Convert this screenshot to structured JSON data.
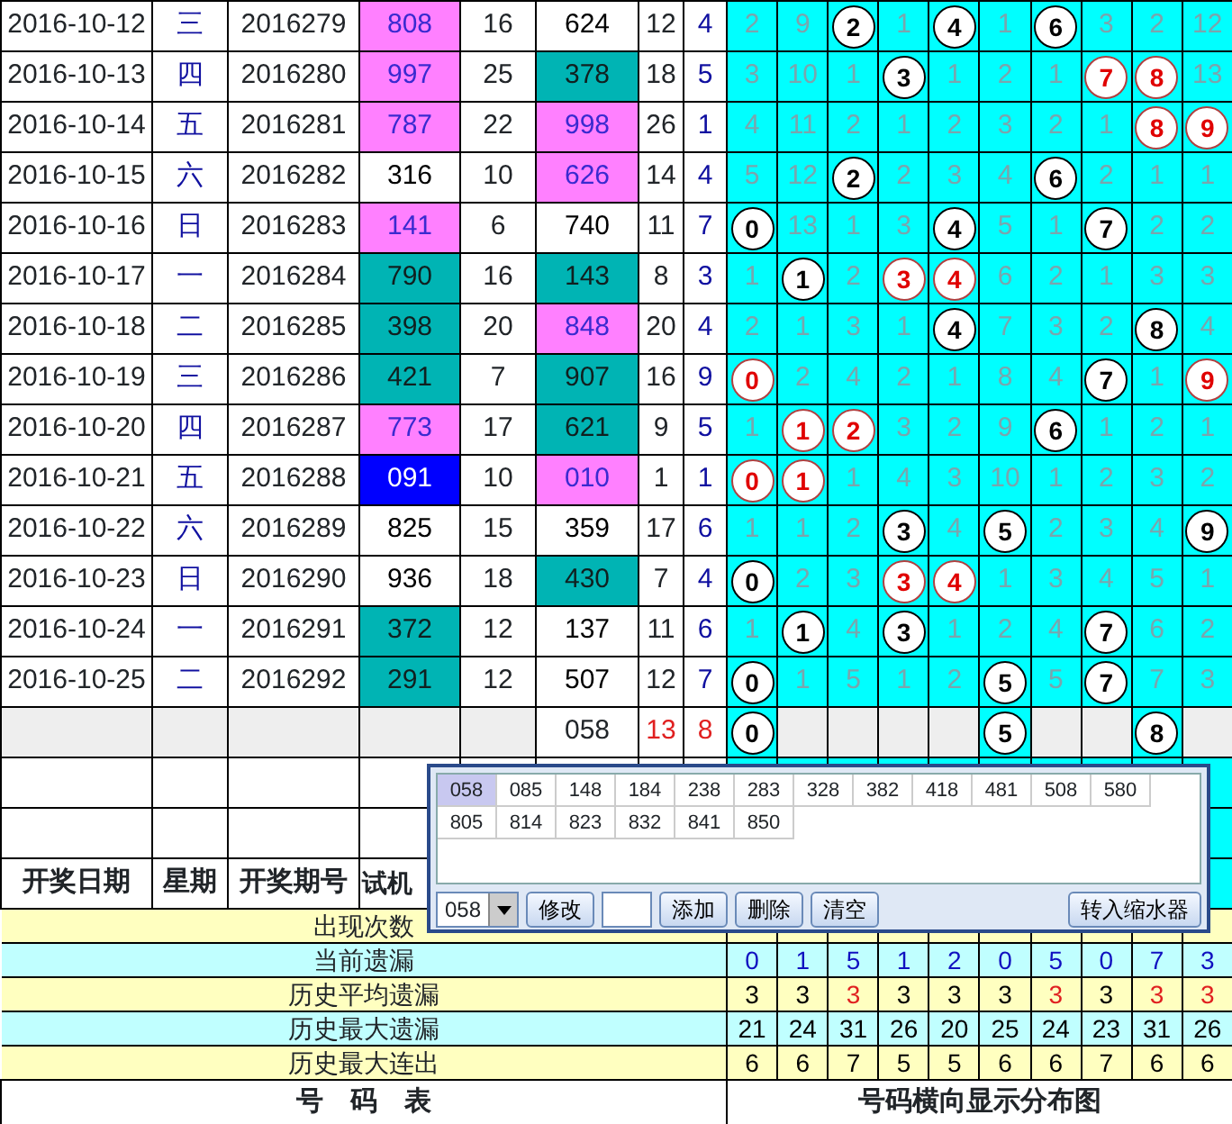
{
  "rows": [
    {
      "date": "2016-10-12",
      "weekday": "三",
      "issue": "2016279",
      "trial": {
        "text": "808",
        "color": "#ff80ff"
      },
      "trial_sum": "16",
      "number": {
        "text": "624",
        "color": "#ffffff"
      },
      "number_sum": "12",
      "column_9": "4",
      "dist": [
        {
          "text": "2",
          "kind": "miss"
        },
        {
          "text": "9",
          "kind": "miss"
        },
        {
          "text": "2",
          "kind": "ball"
        },
        {
          "text": "1",
          "kind": "miss"
        },
        {
          "text": "4",
          "kind": "ball"
        },
        {
          "text": "1",
          "kind": "miss"
        },
        {
          "text": "6",
          "kind": "ball"
        },
        {
          "text": "3",
          "kind": "miss"
        },
        {
          "text": "2",
          "kind": "miss"
        },
        {
          "text": "12",
          "kind": "miss"
        }
      ]
    },
    {
      "date": "2016-10-13",
      "weekday": "四",
      "issue": "2016280",
      "trial": {
        "text": "997",
        "color": "#ff80ff"
      },
      "trial_sum": "25",
      "number": {
        "text": "378",
        "color": "#00b4b4"
      },
      "number_sum": "18",
      "column_9": "5",
      "dist": [
        {
          "text": "3",
          "kind": "miss"
        },
        {
          "text": "10",
          "kind": "miss"
        },
        {
          "text": "1",
          "kind": "miss"
        },
        {
          "text": "3",
          "kind": "ball"
        },
        {
          "text": "1",
          "kind": "miss"
        },
        {
          "text": "2",
          "kind": "miss"
        },
        {
          "text": "1",
          "kind": "miss"
        },
        {
          "text": "7",
          "kind": "repeat"
        },
        {
          "text": "8",
          "kind": "repeat"
        },
        {
          "text": "13",
          "kind": "miss"
        }
      ]
    },
    {
      "date": "2016-10-14",
      "weekday": "五",
      "issue": "2016281",
      "trial": {
        "text": "787",
        "color": "#ff80ff"
      },
      "trial_sum": "22",
      "number": {
        "text": "998",
        "color": "#ff80ff"
      },
      "number_sum": "26",
      "column_9": "1",
      "dist": [
        {
          "text": "4",
          "kind": "miss"
        },
        {
          "text": "11",
          "kind": "miss"
        },
        {
          "text": "2",
          "kind": "miss"
        },
        {
          "text": "1",
          "kind": "miss"
        },
        {
          "text": "2",
          "kind": "miss"
        },
        {
          "text": "3",
          "kind": "miss"
        },
        {
          "text": "2",
          "kind": "miss"
        },
        {
          "text": "1",
          "kind": "miss"
        },
        {
          "text": "8",
          "kind": "repeat"
        },
        {
          "text": "9",
          "kind": "repeat"
        }
      ]
    },
    {
      "date": "2016-10-15",
      "weekday": "六",
      "issue": "2016282",
      "trial": {
        "text": "316",
        "color": "#ffffff"
      },
      "trial_sum": "10",
      "number": {
        "text": "626",
        "color": "#ff80ff"
      },
      "number_sum": "14",
      "column_9": "4",
      "dist": [
        {
          "text": "5",
          "kind": "miss"
        },
        {
          "text": "12",
          "kind": "miss"
        },
        {
          "text": "2",
          "kind": "ball"
        },
        {
          "text": "2",
          "kind": "miss"
        },
        {
          "text": "3",
          "kind": "miss"
        },
        {
          "text": "4",
          "kind": "miss"
        },
        {
          "text": "6",
          "kind": "ball"
        },
        {
          "text": "2",
          "kind": "miss"
        },
        {
          "text": "1",
          "kind": "miss"
        },
        {
          "text": "1",
          "kind": "miss"
        }
      ]
    },
    {
      "date": "2016-10-16",
      "weekday": "日",
      "issue": "2016283",
      "trial": {
        "text": "141",
        "color": "#ff80ff"
      },
      "trial_sum": "6",
      "number": {
        "text": "740",
        "color": "#ffffff"
      },
      "number_sum": "11",
      "column_9": "7",
      "dist": [
        {
          "text": "0",
          "kind": "ball"
        },
        {
          "text": "13",
          "kind": "miss"
        },
        {
          "text": "1",
          "kind": "miss"
        },
        {
          "text": "3",
          "kind": "miss"
        },
        {
          "text": "4",
          "kind": "ball"
        },
        {
          "text": "5",
          "kind": "miss"
        },
        {
          "text": "1",
          "kind": "miss"
        },
        {
          "text": "7",
          "kind": "ball"
        },
        {
          "text": "2",
          "kind": "miss"
        },
        {
          "text": "2",
          "kind": "miss"
        }
      ]
    },
    {
      "date": "2016-10-17",
      "weekday": "一",
      "issue": "2016284",
      "trial": {
        "text": "790",
        "color": "#00b4b4"
      },
      "trial_sum": "16",
      "number": {
        "text": "143",
        "color": "#00b4b4"
      },
      "number_sum": "8",
      "column_9": "3",
      "dist": [
        {
          "text": "1",
          "kind": "miss"
        },
        {
          "text": "1",
          "kind": "ball"
        },
        {
          "text": "2",
          "kind": "miss"
        },
        {
          "text": "3",
          "kind": "repeat"
        },
        {
          "text": "4",
          "kind": "repeat"
        },
        {
          "text": "6",
          "kind": "miss"
        },
        {
          "text": "2",
          "kind": "miss"
        },
        {
          "text": "1",
          "kind": "miss"
        },
        {
          "text": "3",
          "kind": "miss"
        },
        {
          "text": "3",
          "kind": "miss"
        }
      ]
    },
    {
      "date": "2016-10-18",
      "weekday": "二",
      "issue": "2016285",
      "trial": {
        "text": "398",
        "color": "#00b4b4"
      },
      "trial_sum": "20",
      "number": {
        "text": "848",
        "color": "#ff80ff"
      },
      "number_sum": "20",
      "column_9": "4",
      "dist": [
        {
          "text": "2",
          "kind": "miss"
        },
        {
          "text": "1",
          "kind": "miss"
        },
        {
          "text": "3",
          "kind": "miss"
        },
        {
          "text": "1",
          "kind": "miss"
        },
        {
          "text": "4",
          "kind": "ball"
        },
        {
          "text": "7",
          "kind": "miss"
        },
        {
          "text": "3",
          "kind": "miss"
        },
        {
          "text": "2",
          "kind": "miss"
        },
        {
          "text": "8",
          "kind": "ball"
        },
        {
          "text": "4",
          "kind": "miss"
        }
      ]
    },
    {
      "date": "2016-10-19",
      "weekday": "三",
      "issue": "2016286",
      "trial": {
        "text": "421",
        "color": "#00b4b4"
      },
      "trial_sum": "7",
      "number": {
        "text": "907",
        "color": "#00b4b4"
      },
      "number_sum": "16",
      "column_9": "9",
      "dist": [
        {
          "text": "0",
          "kind": "repeat"
        },
        {
          "text": "2",
          "kind": "miss"
        },
        {
          "text": "4",
          "kind": "miss"
        },
        {
          "text": "2",
          "kind": "miss"
        },
        {
          "text": "1",
          "kind": "miss"
        },
        {
          "text": "8",
          "kind": "miss"
        },
        {
          "text": "4",
          "kind": "miss"
        },
        {
          "text": "7",
          "kind": "ball"
        },
        {
          "text": "1",
          "kind": "miss"
        },
        {
          "text": "9",
          "kind": "repeat"
        }
      ]
    },
    {
      "date": "2016-10-20",
      "weekday": "四",
      "issue": "2016287",
      "trial": {
        "text": "773",
        "color": "#ff80ff"
      },
      "trial_sum": "17",
      "number": {
        "text": "621",
        "color": "#00b4b4"
      },
      "number_sum": "9",
      "column_9": "5",
      "dist": [
        {
          "text": "1",
          "kind": "miss"
        },
        {
          "text": "1",
          "kind": "repeat"
        },
        {
          "text": "2",
          "kind": "repeat"
        },
        {
          "text": "3",
          "kind": "miss"
        },
        {
          "text": "2",
          "kind": "miss"
        },
        {
          "text": "9",
          "kind": "miss"
        },
        {
          "text": "6",
          "kind": "ball"
        },
        {
          "text": "1",
          "kind": "miss"
        },
        {
          "text": "2",
          "kind": "miss"
        },
        {
          "text": "1",
          "kind": "miss"
        }
      ]
    },
    {
      "date": "2016-10-21",
      "weekday": "五",
      "issue": "2016288",
      "trial": {
        "text": "091",
        "color": "#0000ff"
      },
      "trial_sum": "10",
      "number": {
        "text": "010",
        "color": "#ff80ff"
      },
      "number_sum": "1",
      "column_9": "1",
      "dist": [
        {
          "text": "0",
          "kind": "repeat"
        },
        {
          "text": "1",
          "kind": "repeat"
        },
        {
          "text": "1",
          "kind": "miss"
        },
        {
          "text": "4",
          "kind": "miss"
        },
        {
          "text": "3",
          "kind": "miss"
        },
        {
          "text": "10",
          "kind": "miss"
        },
        {
          "text": "1",
          "kind": "miss"
        },
        {
          "text": "2",
          "kind": "miss"
        },
        {
          "text": "3",
          "kind": "miss"
        },
        {
          "text": "2",
          "kind": "miss"
        }
      ]
    },
    {
      "date": "2016-10-22",
      "weekday": "六",
      "issue": "2016289",
      "trial": {
        "text": "825",
        "color": "#ffffff"
      },
      "trial_sum": "15",
      "number": {
        "text": "359",
        "color": "#ffffff"
      },
      "number_sum": "17",
      "column_9": "6",
      "dist": [
        {
          "text": "1",
          "kind": "miss"
        },
        {
          "text": "1",
          "kind": "miss"
        },
        {
          "text": "2",
          "kind": "miss"
        },
        {
          "text": "3",
          "kind": "ball"
        },
        {
          "text": "4",
          "kind": "miss"
        },
        {
          "text": "5",
          "kind": "ball"
        },
        {
          "text": "2",
          "kind": "miss"
        },
        {
          "text": "3",
          "kind": "miss"
        },
        {
          "text": "4",
          "kind": "miss"
        },
        {
          "text": "9",
          "kind": "ball"
        }
      ]
    },
    {
      "date": "2016-10-23",
      "weekday": "日",
      "issue": "2016290",
      "trial": {
        "text": "936",
        "color": "#ffffff"
      },
      "trial_sum": "18",
      "number": {
        "text": "430",
        "color": "#00b4b4"
      },
      "number_sum": "7",
      "column_9": "4",
      "dist": [
        {
          "text": "0",
          "kind": "ball"
        },
        {
          "text": "2",
          "kind": "miss"
        },
        {
          "text": "3",
          "kind": "miss"
        },
        {
          "text": "3",
          "kind": "repeat"
        },
        {
          "text": "4",
          "kind": "repeat"
        },
        {
          "text": "1",
          "kind": "miss"
        },
        {
          "text": "3",
          "kind": "miss"
        },
        {
          "text": "4",
          "kind": "miss"
        },
        {
          "text": "5",
          "kind": "miss"
        },
        {
          "text": "1",
          "kind": "miss"
        }
      ]
    },
    {
      "date": "2016-10-24",
      "weekday": "一",
      "issue": "2016291",
      "trial": {
        "text": "372",
        "color": "#00b4b4"
      },
      "trial_sum": "12",
      "number": {
        "text": "137",
        "color": "#ffffff"
      },
      "number_sum": "11",
      "column_9": "6",
      "dist": [
        {
          "text": "1",
          "kind": "miss"
        },
        {
          "text": "1",
          "kind": "ball"
        },
        {
          "text": "4",
          "kind": "miss"
        },
        {
          "text": "3",
          "kind": "ball"
        },
        {
          "text": "1",
          "kind": "miss"
        },
        {
          "text": "2",
          "kind": "miss"
        },
        {
          "text": "4",
          "kind": "miss"
        },
        {
          "text": "7",
          "kind": "ball"
        },
        {
          "text": "6",
          "kind": "miss"
        },
        {
          "text": "2",
          "kind": "miss"
        }
      ]
    },
    {
      "date": "2016-10-25",
      "weekday": "二",
      "issue": "2016292",
      "trial": {
        "text": "291",
        "color": "#00b4b4"
      },
      "trial_sum": "12",
      "number": {
        "text": "507",
        "color": "#ffffff"
      },
      "number_sum": "12",
      "column_9": "7",
      "dist": [
        {
          "text": "0",
          "kind": "ball"
        },
        {
          "text": "1",
          "kind": "miss"
        },
        {
          "text": "5",
          "kind": "miss"
        },
        {
          "text": "1",
          "kind": "miss"
        },
        {
          "text": "2",
          "kind": "miss"
        },
        {
          "text": "5",
          "kind": "ball"
        },
        {
          "text": "5",
          "kind": "miss"
        },
        {
          "text": "7",
          "kind": "ball"
        },
        {
          "text": "7",
          "kind": "miss"
        },
        {
          "text": "3",
          "kind": "miss"
        }
      ]
    }
  ],
  "forecast_row": {
    "number": "058",
    "number_sum": "13",
    "column_9": "8",
    "dist": [
      {
        "text": "0",
        "kind": "ball"
      },
      {
        "kind": "blank"
      },
      {
        "kind": "blank"
      },
      {
        "kind": "blank"
      },
      {
        "kind": "blank"
      },
      {
        "text": "5",
        "kind": "ball"
      },
      {
        "kind": "blank"
      },
      {
        "kind": "blank"
      },
      {
        "text": "8",
        "kind": "ball"
      },
      {
        "kind": "blank"
      }
    ]
  },
  "header": {
    "columns": [
      "开奖日期",
      "星期",
      "开奖期号",
      "试机"
    ]
  },
  "stats": [
    {
      "label": "出现次数",
      "color": "#ffffc0"
    },
    {
      "label": "当前遗漏",
      "color": "#c0ffff",
      "values": [
        {
          "text": "0",
          "highlight": false
        },
        {
          "text": "1",
          "highlight": false
        },
        {
          "text": "5",
          "highlight": false
        },
        {
          "text": "1",
          "highlight": false
        },
        {
          "text": "2",
          "highlight": false
        },
        {
          "text": "0",
          "highlight": false
        },
        {
          "text": "5",
          "highlight": false
        },
        {
          "text": "0",
          "highlight": false
        },
        {
          "text": "7",
          "highlight": false
        },
        {
          "text": "3",
          "highlight": false
        }
      ],
      "kind": "current"
    },
    {
      "label": "历史平均遗漏",
      "color": "#ffffc0",
      "values": [
        {
          "text": "3",
          "highlight": false
        },
        {
          "text": "3",
          "highlight": false
        },
        {
          "text": "3",
          "highlight": true
        },
        {
          "text": "3",
          "highlight": false
        },
        {
          "text": "3",
          "highlight": false
        },
        {
          "text": "3",
          "highlight": false
        },
        {
          "text": "3",
          "highlight": true
        },
        {
          "text": "3",
          "highlight": false
        },
        {
          "text": "3",
          "highlight": true
        },
        {
          "text": "3",
          "highlight": true
        }
      ],
      "kind": "plain"
    },
    {
      "label": "历史最大遗漏",
      "color": "#c0ffff",
      "values": [
        {
          "text": "21",
          "highlight": false
        },
        {
          "text": "24",
          "highlight": false
        },
        {
          "text": "31",
          "highlight": false
        },
        {
          "text": "26",
          "highlight": false
        },
        {
          "text": "20",
          "highlight": false
        },
        {
          "text": "25",
          "highlight": false
        },
        {
          "text": "24",
          "highlight": false
        },
        {
          "text": "23",
          "highlight": false
        },
        {
          "text": "31",
          "highlight": false
        },
        {
          "text": "26",
          "highlight": false
        }
      ],
      "kind": "plain"
    },
    {
      "label": "历史最大连出",
      "color": "#ffffc0",
      "values": [
        {
          "text": "6",
          "highlight": false
        },
        {
          "text": "6",
          "highlight": false
        },
        {
          "text": "7",
          "highlight": false
        },
        {
          "text": "5",
          "highlight": false
        },
        {
          "text": "5",
          "highlight": false
        },
        {
          "text": "6",
          "highlight": false
        },
        {
          "text": "6",
          "highlight": false
        },
        {
          "text": "7",
          "highlight": false
        },
        {
          "text": "6",
          "highlight": false
        },
        {
          "text": "6",
          "highlight": false
        }
      ],
      "kind": "plain"
    }
  ],
  "footer": {
    "left": "号　码　表",
    "right": "号码横向显示分布图"
  },
  "popup": {
    "numbers": [
      {
        "text": "058",
        "selected": true
      },
      {
        "text": "085",
        "selected": false
      },
      {
        "text": "148",
        "selected": false
      },
      {
        "text": "184",
        "selected": false
      },
      {
        "text": "238",
        "selected": false
      },
      {
        "text": "283",
        "selected": false
      },
      {
        "text": "328",
        "selected": false
      },
      {
        "text": "382",
        "selected": false
      },
      {
        "text": "418",
        "selected": false
      },
      {
        "text": "481",
        "selected": false
      },
      {
        "text": "508",
        "selected": false
      },
      {
        "text": "580",
        "selected": false
      },
      {
        "text": "805",
        "selected": false
      },
      {
        "text": "814",
        "selected": false
      },
      {
        "text": "823",
        "selected": false
      },
      {
        "text": "832",
        "selected": false
      },
      {
        "text": "841",
        "selected": false
      },
      {
        "text": "850",
        "selected": false
      }
    ],
    "dropdown": "058",
    "edit_button": "修改",
    "add_button": "添加",
    "delete_button": "删除",
    "clear_button": "清空",
    "transfer_button": "转入缩水器"
  }
}
